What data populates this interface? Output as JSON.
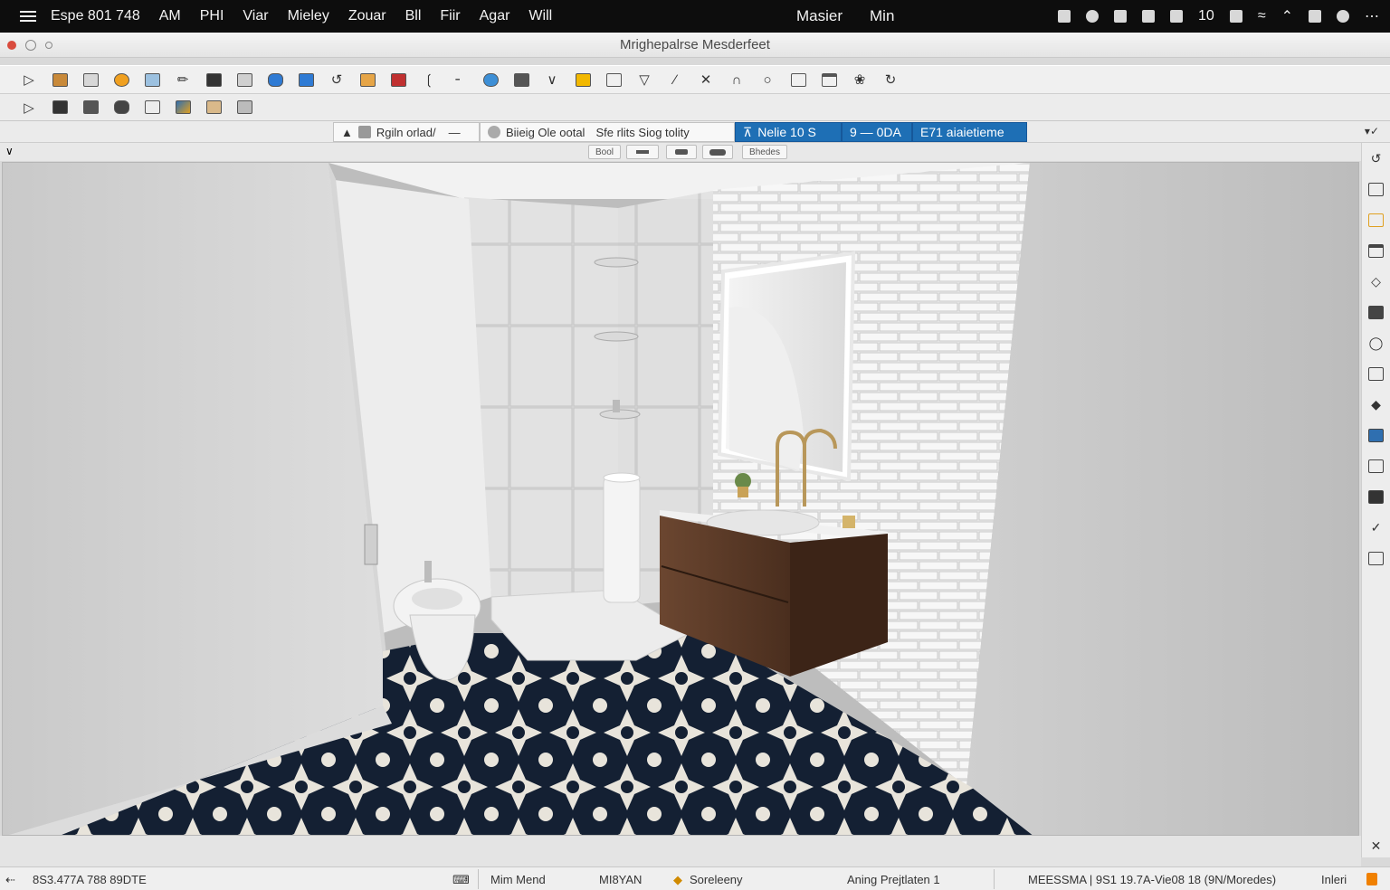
{
  "menubar": {
    "app_menu": "Espe 801 748",
    "items": [
      "AM",
      "PHI",
      "Viar",
      "Mieley",
      "Zouar",
      "Bll",
      "Fiir",
      "Agar",
      "Will"
    ],
    "center_items": [
      "Masier",
      "Min"
    ],
    "status_number": "10"
  },
  "window": {
    "title": "Mrighepalrse Mesderfeet"
  },
  "toolbar1": {
    "icons": [
      "select-arrow-icon",
      "material-icon",
      "image-icon",
      "color-wheel-icon",
      "screen-icon",
      "pencil-icon",
      "layers-icon",
      "grid-icon",
      "paint-bucket-icon",
      "calendar-icon",
      "lasso-icon",
      "folder-icon",
      "ruler-icon",
      "tag-icon",
      "brush-icon",
      "cloud-icon",
      "list-icon",
      "chevron-icon",
      "rectangle-icon",
      "table-icon",
      "triangle-icon",
      "knife-icon",
      "close-icon",
      "arch-icon",
      "circle-icon",
      "panel-icon",
      "window-icon",
      "leaf-icon",
      "refresh-icon"
    ]
  },
  "toolbar2": {
    "icons": [
      "play-icon",
      "save-icon",
      "print-icon",
      "render-icon",
      "clipboard-icon",
      "paint-icon",
      "puzzle-icon",
      "gallery-icon"
    ]
  },
  "options": {
    "seg1": "Rgiln orlad/",
    "seg2a": "Biieig Ole ootal",
    "seg2b": "Sfe rlits Siog tolity",
    "blue1": "Nelie 10 S",
    "blue2": "9 — 0DA",
    "blue3": "E71 aiaietieme"
  },
  "subbar": {
    "pill1": "Bool",
    "pill4": "Bhedes"
  },
  "statusbar": {
    "coords": "8S3.477A 788 89DTE",
    "mode": "Mim Mend",
    "layer": "MI8YAN",
    "scene": "Soreleeny",
    "projection": "Aning Prejtlaten 1",
    "location": "MEESSMA | 9S1 19.7A-Vie08 18 (9N/Moredes)",
    "tail": "Inleri"
  },
  "colors": {
    "accent": "#1e6fb5",
    "menubar": "#0d0d0d",
    "floor_dark": "#142033",
    "floor_light": "#e8e4db",
    "vanity": "#5a3a28"
  }
}
